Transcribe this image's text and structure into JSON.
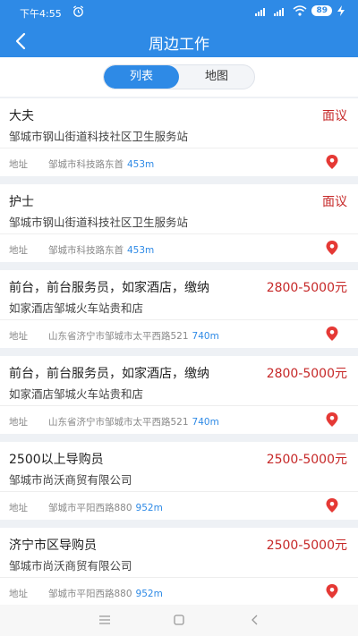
{
  "status_bar": {
    "time": "下午4:55",
    "battery": "89"
  },
  "header": {
    "title": "周边工作"
  },
  "tabs": [
    {
      "label": "列表",
      "active": true
    },
    {
      "label": "地图",
      "active": false
    }
  ],
  "jobs": [
    {
      "title": "大夫",
      "salary": "面议",
      "company": "邹城市钢山街道科技社区卫生服务站",
      "address_label": "地址",
      "address": "邹城市科技路东首",
      "distance": "453m"
    },
    {
      "title": "护士",
      "salary": "面议",
      "company": "邹城市钢山街道科技社区卫生服务站",
      "address_label": "地址",
      "address": "邹城市科技路东首",
      "distance": "453m"
    },
    {
      "title": "前台，前台服务员，如家酒店，缴纳",
      "salary": "2800-5000元",
      "company": "如家酒店邹城火车站贵和店",
      "address_label": "地址",
      "address": "山东省济宁市邹城市太平西路521",
      "distance": "740m"
    },
    {
      "title": "前台，前台服务员，如家酒店，缴纳",
      "salary": "2800-5000元",
      "company": "如家酒店邹城火车站贵和店",
      "address_label": "地址",
      "address": "山东省济宁市邹城市太平西路521",
      "distance": "740m"
    },
    {
      "title": "2500以上导购员",
      "salary": "2500-5000元",
      "company": "邹城市尚沃商贸有限公司",
      "address_label": "地址",
      "address": "邹城市平阳西路880",
      "distance": "952m"
    },
    {
      "title": "济宁市区导购员",
      "salary": "2500-5000元",
      "company": "邹城市尚沃商贸有限公司",
      "address_label": "地址",
      "address": "邹城市平阳西路880",
      "distance": "952m"
    }
  ],
  "colors": {
    "primary": "#2e8ae6",
    "salary": "#c62828",
    "pin": "#e53935"
  }
}
